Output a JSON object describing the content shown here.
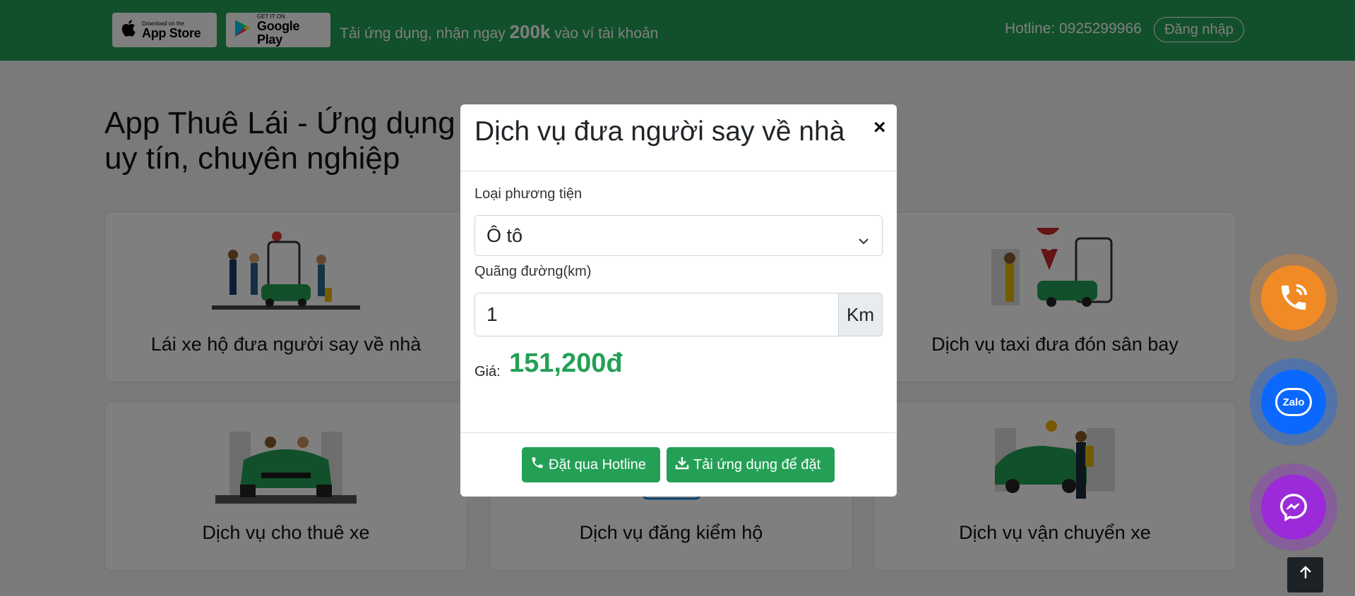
{
  "topbar": {
    "appstore_small": "Download on the",
    "appstore_big": "App Store",
    "googleplay_small": "GET IT ON",
    "googleplay_big": "Google Play",
    "promo_pre": "Tải ứng dụng, nhận ngay ",
    "promo_amount": "200k",
    "promo_post": " vào ví tài khoản",
    "hotline": "Hotline: 0925299966",
    "login": "Đăng nhập"
  },
  "page": {
    "title_line1": "App Thuê Lái - Ứng dụng",
    "title_line2": "uy tín, chuyên nghiệp",
    "cards": [
      {
        "label": "Lái xe hộ đưa người say về nhà"
      },
      {
        "label": "Dịch vụ taxi đưa đón sân bay"
      },
      {
        "label": "Dịch vụ cho thuê xe"
      },
      {
        "label": "Dịch vụ đăng kiểm hộ"
      },
      {
        "label": "Dịch vụ vận chuyển xe"
      }
    ]
  },
  "modal": {
    "title": "Dịch vụ đưa người say về nhà",
    "close": "×",
    "vehicle_label": "Loại phương tiện",
    "vehicle_value": "Ô tô",
    "distance_label": "Quãng đường(km)",
    "distance_value": "1",
    "distance_unit": "Km",
    "price_label": "Giá:",
    "price_value": "151,200đ",
    "btn_hotline": "Đặt qua Hotline",
    "btn_app": "Tải ứng dụng để đặt"
  },
  "fab": {
    "zalo": "Zalo"
  },
  "colors": {
    "brand_green": "#23a055",
    "phone_orange": "#f08a24",
    "zalo_blue": "#0b68ff",
    "messenger_purple": "#9b2bd8"
  }
}
